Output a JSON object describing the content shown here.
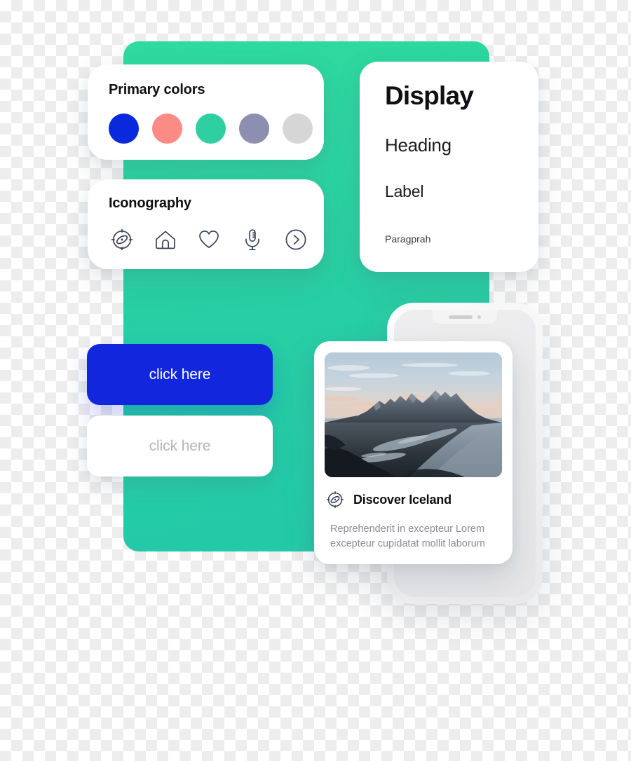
{
  "theme": {
    "panel_gradient_top": "#2FDB9E",
    "panel_gradient_bottom": "#22C9A9",
    "accent_blue": "#1226DD",
    "text_dark": "#101014",
    "text_muted": "#8B8B95"
  },
  "primary_colors_card": {
    "title": "Primary colors",
    "swatches": [
      {
        "name": "blue",
        "hex": "#0A28DC"
      },
      {
        "name": "salmon",
        "hex": "#FC8B85"
      },
      {
        "name": "green",
        "hex": "#2ED0A2"
      },
      {
        "name": "slate-purple",
        "hex": "#8C8FB0"
      },
      {
        "name": "light-grey",
        "hex": "#D6D6D7"
      }
    ]
  },
  "iconography_card": {
    "title": "Iconography",
    "icons": [
      {
        "name": "compass-icon"
      },
      {
        "name": "home-icon"
      },
      {
        "name": "heart-icon"
      },
      {
        "name": "microphone-icon"
      },
      {
        "name": "chevron-right-circle-icon"
      }
    ]
  },
  "typography_card": {
    "display": "Display",
    "heading": "Heading",
    "label": "Label",
    "paragraph": "Paragprah"
  },
  "buttons": {
    "primary_label": "click here",
    "secondary_label": "click here"
  },
  "iceland_card": {
    "icon": "compass-icon",
    "title": "Discover Iceland",
    "description": "Reprehenderit in excepteur Lorem excepteur cupidatat mollit laborum",
    "photo_alt": "Vestrahorn mountain over black sand beach at dusk"
  },
  "phone_mockup": {
    "notch_speaker": "speaker-grille",
    "notch_camera": "front-camera-dot"
  }
}
